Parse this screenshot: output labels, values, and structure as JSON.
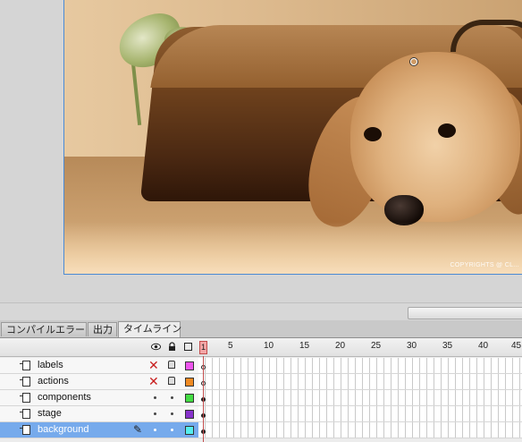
{
  "stage": {
    "watermark": "COPYRIGHTS @ CL..."
  },
  "panel_tabs": [
    {
      "label": "コンパイルエラー"
    },
    {
      "label": "出力"
    },
    {
      "label": "タイムライン",
      "active": true
    }
  ],
  "timeline": {
    "header_icons": [
      "eye-icon",
      "lock-icon",
      "outline-icon"
    ],
    "current_frame": "1",
    "ruler_numbers": [
      "5",
      "10",
      "15",
      "20",
      "25",
      "30",
      "35",
      "40",
      "45"
    ],
    "layers": [
      {
        "name": "labels",
        "visible": false,
        "locked": true,
        "color": "#ee55ee",
        "selected": false
      },
      {
        "name": "actions",
        "visible": false,
        "locked": true,
        "color": "#f08a22",
        "selected": false
      },
      {
        "name": "components",
        "visible": true,
        "locked": false,
        "color": "#44dd44",
        "selected": false
      },
      {
        "name": "stage",
        "visible": true,
        "locked": false,
        "color": "#8833cc",
        "selected": false
      },
      {
        "name": "background",
        "visible": true,
        "locked": false,
        "color": "#55eeee",
        "selected": true
      }
    ]
  }
}
